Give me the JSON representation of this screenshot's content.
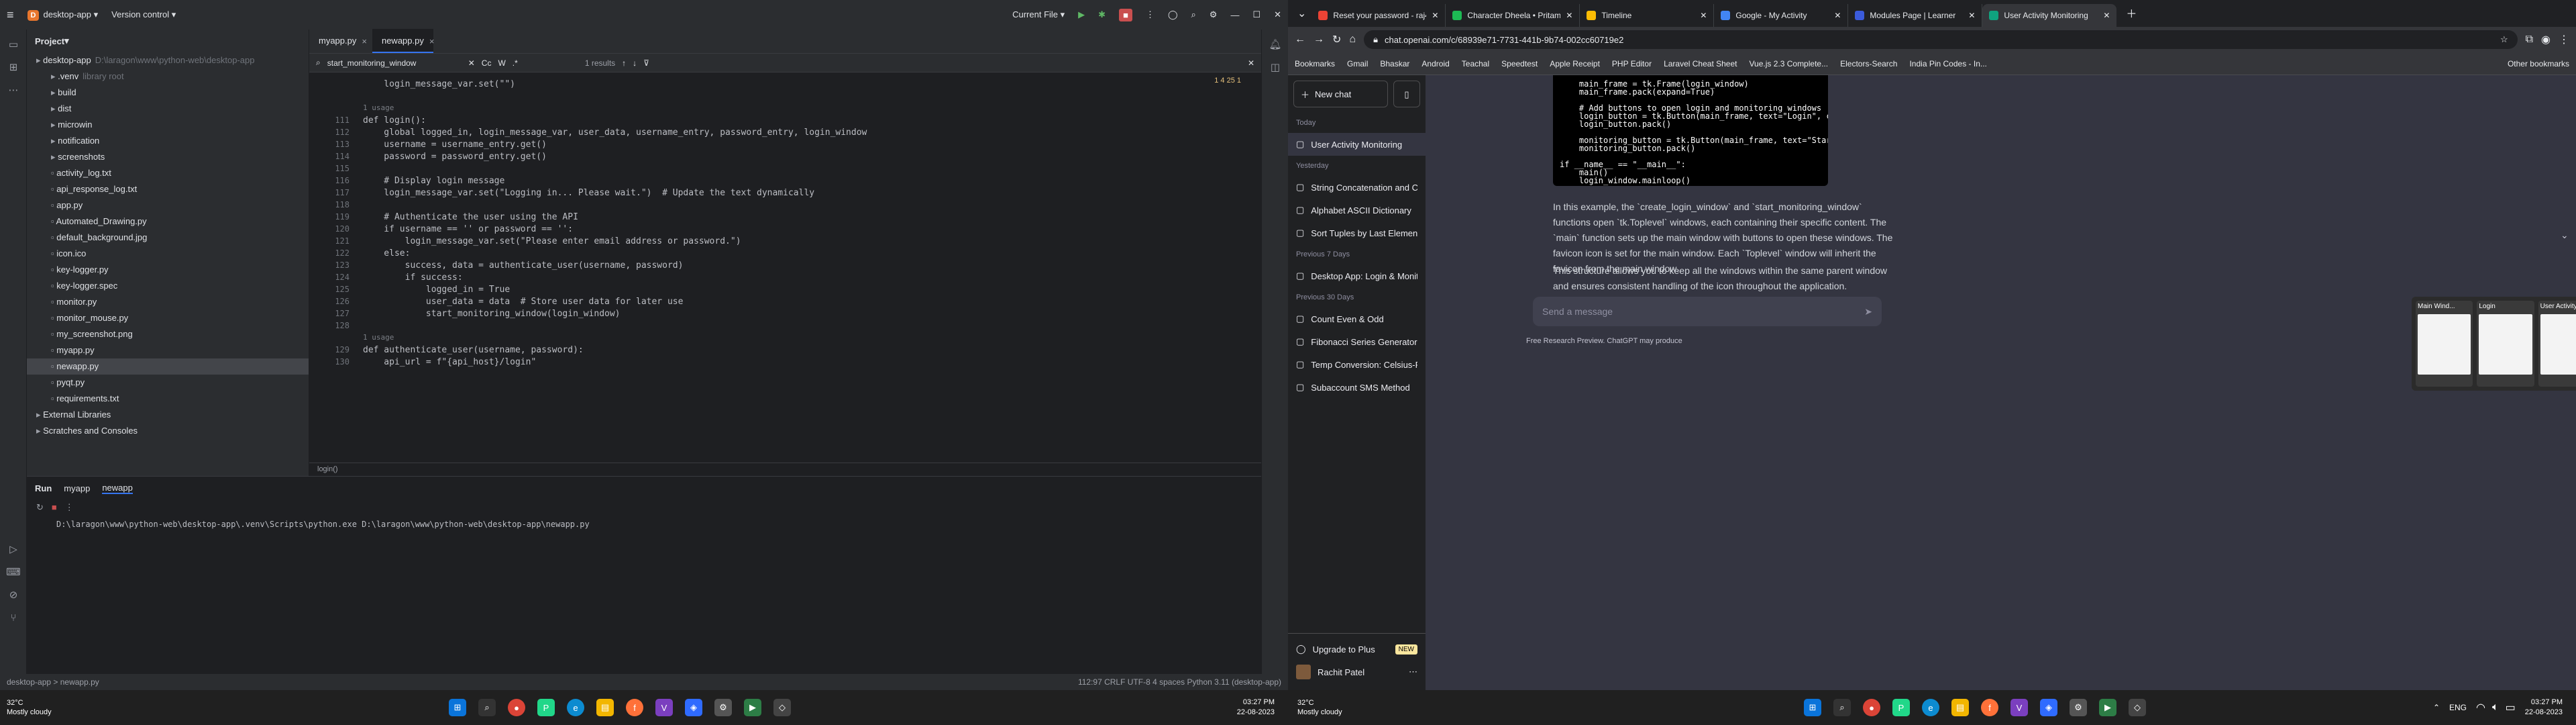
{
  "ide": {
    "badge": "D",
    "project_name": "desktop-app",
    "vcs": "Version control",
    "run_config": "Current File",
    "sidebar_title": "Project",
    "tree": [
      {
        "t": "desktop-app",
        "hint": "D:\\laragon\\www\\python-web\\desktop-app",
        "lvl": 0
      },
      {
        "t": ".venv",
        "hint": "library root",
        "lvl": 1
      },
      {
        "t": "build",
        "lvl": 1
      },
      {
        "t": "dist",
        "lvl": 1
      },
      {
        "t": "microwin",
        "lvl": 1
      },
      {
        "t": "notification",
        "lvl": 1
      },
      {
        "t": "screenshots",
        "lvl": 1
      },
      {
        "t": "activity_log.txt",
        "lvl": 1
      },
      {
        "t": "api_response_log.txt",
        "lvl": 1
      },
      {
        "t": "app.py",
        "lvl": 1
      },
      {
        "t": "Automated_Drawing.py",
        "lvl": 1
      },
      {
        "t": "default_background.jpg",
        "lvl": 1
      },
      {
        "t": "icon.ico",
        "lvl": 1
      },
      {
        "t": "key-logger.py",
        "lvl": 1
      },
      {
        "t": "key-logger.spec",
        "lvl": 1
      },
      {
        "t": "monitor.py",
        "lvl": 1
      },
      {
        "t": "monitor_mouse.py",
        "lvl": 1
      },
      {
        "t": "my_screenshot.png",
        "lvl": 1
      },
      {
        "t": "myapp.py",
        "lvl": 1
      },
      {
        "t": "newapp.py",
        "lvl": 1,
        "sel": true
      },
      {
        "t": "pyqt.py",
        "lvl": 1
      },
      {
        "t": "requirements.txt",
        "lvl": 1
      },
      {
        "t": "External Libraries",
        "lvl": 0
      },
      {
        "t": "Scratches and Consoles",
        "lvl": 0
      }
    ],
    "tabs": [
      "myapp.py",
      "newapp.py"
    ],
    "find": {
      "query": "start_monitoring_window",
      "results": "1 results"
    },
    "inspections": "1  4  25  1",
    "lines": [
      {
        "n": "",
        "c": "    login_message_var.set(\"\")"
      },
      {
        "n": "",
        "c": ""
      },
      {
        "n": "",
        "c": "1 usage",
        "hint": true
      },
      {
        "n": "111",
        "c": "def login():"
      },
      {
        "n": "112",
        "c": "    global logged_in, login_message_var, user_data, username_entry, password_entry, login_window"
      },
      {
        "n": "113",
        "c": "    username = username_entry.get()"
      },
      {
        "n": "114",
        "c": "    password = password_entry.get()"
      },
      {
        "n": "115",
        "c": ""
      },
      {
        "n": "116",
        "c": "    # Display login message"
      },
      {
        "n": "117",
        "c": "    login_message_var.set(\"Logging in... Please wait.\")  # Update the text dynamically"
      },
      {
        "n": "118",
        "c": ""
      },
      {
        "n": "119",
        "c": "    # Authenticate the user using the API"
      },
      {
        "n": "120",
        "c": "    if username == '' or password == '':"
      },
      {
        "n": "121",
        "c": "        login_message_var.set(\"Please enter email address or password.\")"
      },
      {
        "n": "122",
        "c": "    else:"
      },
      {
        "n": "123",
        "c": "        success, data = authenticate_user(username, password)"
      },
      {
        "n": "124",
        "c": "        if success:"
      },
      {
        "n": "125",
        "c": "            logged_in = True"
      },
      {
        "n": "126",
        "c": "            user_data = data  # Store user data for later use"
      },
      {
        "n": "127",
        "c": "            start_monitoring_window(login_window)"
      },
      {
        "n": "128",
        "c": ""
      },
      {
        "n": "",
        "c": "1 usage",
        "hint": true
      },
      {
        "n": "129",
        "c": "def authenticate_user(username, password):"
      },
      {
        "n": "130",
        "c": "    api_url = f\"{api_host}/login\""
      }
    ],
    "breadcrumb_fn": "login()",
    "run_label": "Run",
    "run_tabs": [
      "myapp",
      "newapp"
    ],
    "run_cmd": "D:\\laragon\\www\\python-web\\desktop-app\\.venv\\Scripts\\python.exe D:\\laragon\\www\\python-web\\desktop-app\\newapp.py",
    "status_path": "desktop-app  >  newapp.py",
    "status_right": "112:97   CRLF   UTF-8   4 spaces   Python 3.11 (desktop-app)"
  },
  "taskbar1": {
    "time": "03:27 PM",
    "date": "22-08-2023",
    "weather_temp": "32°C",
    "weather_desc": "Mostly cloudy"
  },
  "chrome": {
    "tabs": [
      {
        "t": "Reset your password - raj4...",
        "c": "#ea4335"
      },
      {
        "t": "Character Dheela • Pritam...",
        "c": "#1db954"
      },
      {
        "t": "Timeline",
        "c": "#fbbc04"
      },
      {
        "t": "Google - My Activity",
        "c": "#4285f4"
      },
      {
        "t": "Modules Page | Learner",
        "c": "#3b5bdb"
      },
      {
        "t": "User Activity Monitoring",
        "c": "#10a37f",
        "active": true
      }
    ],
    "url": "chat.openai.com/c/68939e71-7731-441b-9b74-002cc60719e2",
    "bookmarks": [
      "Bookmarks",
      "Gmail",
      "Bhaskar",
      "Android",
      "Teachal",
      "Speedtest",
      "Apple Receipt",
      "PHP Editor",
      "Laravel Cheat Sheet",
      "Vue.js 2.3 Complete...",
      "Electors-Search",
      "India Pin Codes - In..."
    ],
    "other_bm": "Other bookmarks"
  },
  "chatgpt": {
    "new_chat": "New chat",
    "sections": [
      {
        "h": "Today",
        "items": [
          "User Activity Monitoring"
        ]
      },
      {
        "h": "Yesterday",
        "items": [
          "String Concatenation and Che",
          "Alphabet ASCII Dictionary",
          "Sort Tuples by Last Element"
        ]
      },
      {
        "h": "Previous 7 Days",
        "items": [
          "Desktop App: Login & Monitor"
        ]
      },
      {
        "h": "Previous 30 Days",
        "items": [
          "Count Even & Odd",
          "Fibonacci Series Generator",
          "Temp Conversion: Celsius-Fah",
          "Subaccount SMS Method"
        ]
      }
    ],
    "upgrade": "Upgrade to Plus",
    "new_badge": "NEW",
    "user": "Rachit Patel",
    "code": [
      "    main_frame = tk.Frame(login_window)",
      "    main_frame.pack(expand=True)",
      "",
      "    # Add buttons to open login and monitoring windows",
      "    login_button = tk.Button(main_frame, text=\"Login\", command=lambda: creat",
      "    login_button.pack()",
      "",
      "    monitoring_button = tk.Button(main_frame, text=\"Start Monitoring\", comma",
      "    monitoring_button.pack()",
      "",
      "if __name__ == \"__main__\":",
      "    main()",
      "    login_window.mainloop()"
    ],
    "p1": "In this example, the `create_login_window` and `start_monitoring_window` functions open `tk.Toplevel` windows, each containing their specific content. The `main` function sets up the main window with buttons to open these windows. The favicon icon is set for the main window. Each `Toplevel` window will inherit the favicon from the main window.",
    "p2": "This structure allows you to keep all the windows within the same parent window and ensures consistent handling of the icon throughout the application.",
    "input_placeholder": "Send a message",
    "footer": "Free Research Preview. ChatGPT may produce",
    "previews": [
      "Main Wind...",
      "Login",
      "User Activity Monit..."
    ]
  },
  "taskbar2": {
    "weather_temp": "32°C",
    "weather_desc": "Mostly cloudy",
    "lang": "ENG",
    "time": "03:27 PM",
    "date": "22-08-2023"
  }
}
